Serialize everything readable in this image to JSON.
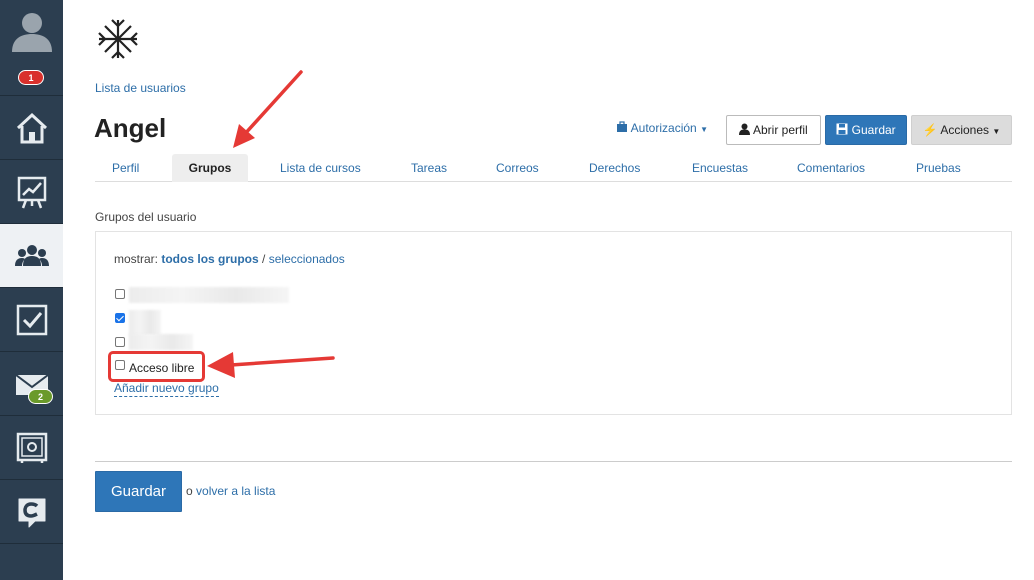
{
  "sidebar": {
    "notifications_badge": "1",
    "mail_badge": "2",
    "colors": {
      "background": "#2c3e50",
      "active": "#eef1f4"
    }
  },
  "breadcrumb": "Lista de usuarios",
  "title": "Angel",
  "toolbar": {
    "authorization_label": "Autorización",
    "open_profile_label": "Abrir perfil",
    "save_label": "Guardar",
    "actions_label": "Acciones"
  },
  "tabs": [
    {
      "label": "Perfil"
    },
    {
      "label": "Grupos",
      "active": true
    },
    {
      "label": "Lista de cursos"
    },
    {
      "label": "Tareas"
    },
    {
      "label": "Correos"
    },
    {
      "label": "Derechos"
    },
    {
      "label": "Encuestas"
    },
    {
      "label": "Comentarios"
    },
    {
      "label": "Pruebas"
    }
  ],
  "groups": {
    "section_label": "Grupos del usuario",
    "show_prefix": "mostrar:",
    "filter_all": "todos los grupos",
    "separator": "/",
    "filter_selected": "seleccionados",
    "items": [
      {
        "checked": false
      },
      {
        "checked": true
      },
      {
        "checked": false
      },
      {
        "label": "Acceso libre",
        "checked": false
      }
    ],
    "add_group_label": "Añadir nuevo grupo"
  },
  "footer": {
    "save_label": "Guardar",
    "or_text": "o",
    "back_link": "volver a la lista"
  },
  "colors": {
    "primary": "#2e76b8",
    "link": "#2d6ea8",
    "annotation": "#e53935"
  }
}
